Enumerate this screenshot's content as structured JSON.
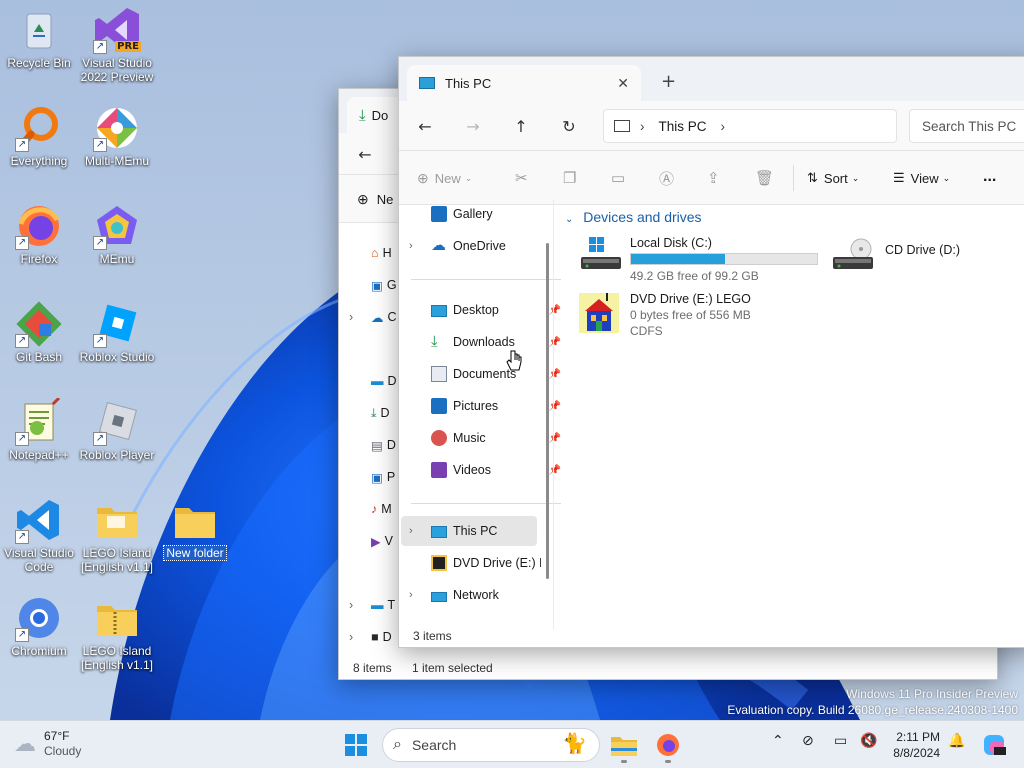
{
  "desktop": {
    "icons": [
      {
        "label": "Recycle Bin",
        "icon": "recycle-bin-icon"
      },
      {
        "label": "Visual Studio 2022 Preview",
        "icon": "visual-studio-icon",
        "badge": "PRE"
      },
      {
        "label": "Everything",
        "icon": "everything-search-icon"
      },
      {
        "label": "Multi-MEmu",
        "icon": "multi-memu-icon"
      },
      {
        "label": "Firefox",
        "icon": "firefox-icon"
      },
      {
        "label": "MEmu",
        "icon": "memu-icon"
      },
      {
        "label": "Git Bash",
        "icon": "git-bash-icon"
      },
      {
        "label": "Roblox Studio",
        "icon": "roblox-studio-icon"
      },
      {
        "label": "Notepad++",
        "icon": "notepad-plus-plus-icon"
      },
      {
        "label": "Roblox Player",
        "icon": "roblox-player-icon"
      },
      {
        "label": "Visual Studio Code",
        "icon": "vscode-icon"
      },
      {
        "label": "LEGO Island [English v1.1]",
        "icon": "folder-icon"
      },
      {
        "label": "New folder",
        "icon": "folder-icon",
        "selected": true
      },
      {
        "label": "Chromium",
        "icon": "chromium-icon"
      },
      {
        "label": "LEGO Island [English v1.1]",
        "icon": "zip-folder-icon"
      }
    ],
    "watermark": {
      "line1": "Windows 11 Pro Insider Preview",
      "line2": "Evaluation copy. Build 26080.ge_release.240308-1400"
    }
  },
  "back_window": {
    "tab_title": "Do",
    "new_label": "Ne",
    "sidebar_letters": [
      "H",
      "G",
      "C",
      "D",
      "D",
      "D",
      "P",
      "M",
      "V",
      "T",
      "D"
    ],
    "status_count": "8 items",
    "status_selected": "1 item selected"
  },
  "front_window": {
    "tab_title": "This PC",
    "new_tab": "+",
    "breadcrumb": "This PC",
    "search_placeholder": "Search This PC",
    "commands": {
      "new": "New",
      "sort": "Sort",
      "view": "View",
      "more": "..."
    },
    "sidebar": {
      "top": [
        {
          "label": "Gallery",
          "icon": "gallery-icon"
        },
        {
          "label": "OneDrive",
          "icon": "onedrive-icon"
        }
      ],
      "quick": [
        {
          "label": "Desktop",
          "icon": "desktop-icon"
        },
        {
          "label": "Downloads",
          "icon": "downloads-icon"
        },
        {
          "label": "Documents",
          "icon": "documents-icon"
        },
        {
          "label": "Pictures",
          "icon": "pictures-icon"
        },
        {
          "label": "Music",
          "icon": "music-icon"
        },
        {
          "label": "Videos",
          "icon": "videos-icon"
        }
      ],
      "bottom": [
        {
          "label": "This PC",
          "icon": "computer-icon"
        },
        {
          "label": "DVD Drive (E:) LE",
          "icon": "lego-disc-icon"
        },
        {
          "label": "Network",
          "icon": "network-icon"
        }
      ]
    },
    "section_title": "Devices and drives",
    "drives": [
      {
        "name": "Local Disk (C:)",
        "detail": "49.2 GB free of 99.2 GB",
        "used_fraction": 0.504
      },
      {
        "name": "CD Drive (D:)"
      },
      {
        "name": "DVD Drive (E:) LEGO",
        "detail": "0 bytes free of 556 MB",
        "fs": "CDFS"
      }
    ],
    "status_items": "3 items"
  },
  "taskbar": {
    "weather_temp": "67°F",
    "weather_desc": "Cloudy",
    "search_label": "Search",
    "time": "2:11 PM",
    "date": "8/8/2024"
  },
  "colors": {
    "accent": "#0067c0",
    "folder": "#f5c542",
    "selection": "#1f5fc7",
    "taskbar": "#e9eef5"
  }
}
